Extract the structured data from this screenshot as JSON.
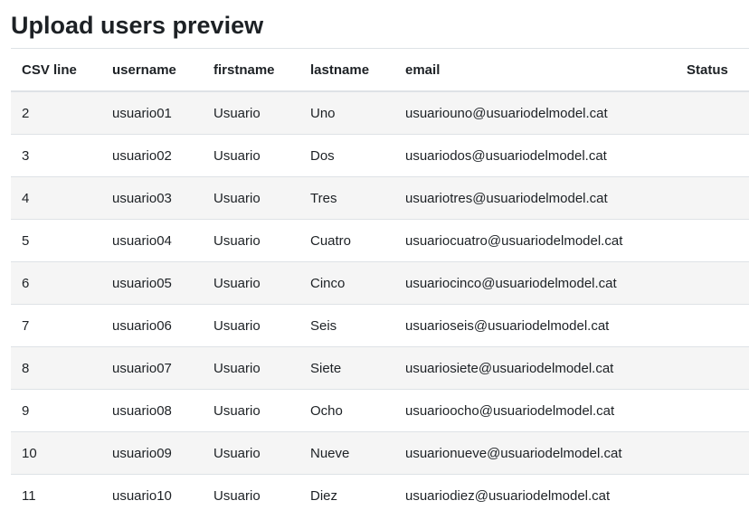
{
  "page": {
    "title": "Upload users preview"
  },
  "table": {
    "headers": {
      "csv_line": "CSV line",
      "username": "username",
      "firstname": "firstname",
      "lastname": "lastname",
      "email": "email",
      "status": "Status"
    },
    "rows": [
      {
        "line": "2",
        "username": "usuario01",
        "firstname": "Usuario",
        "lastname": "Uno",
        "email": "usuariouno@usuariodelmodel.cat",
        "status": ""
      },
      {
        "line": "3",
        "username": "usuario02",
        "firstname": "Usuario",
        "lastname": "Dos",
        "email": "usuariodos@usuariodelmodel.cat",
        "status": ""
      },
      {
        "line": "4",
        "username": "usuario03",
        "firstname": "Usuario",
        "lastname": "Tres",
        "email": "usuariotres@usuariodelmodel.cat",
        "status": ""
      },
      {
        "line": "5",
        "username": "usuario04",
        "firstname": "Usuario",
        "lastname": "Cuatro",
        "email": "usuariocuatro@usuariodelmodel.cat",
        "status": ""
      },
      {
        "line": "6",
        "username": "usuario05",
        "firstname": "Usuario",
        "lastname": "Cinco",
        "email": "usuariocinco@usuariodelmodel.cat",
        "status": ""
      },
      {
        "line": "7",
        "username": "usuario06",
        "firstname": "Usuario",
        "lastname": "Seis",
        "email": "usuarioseis@usuariodelmodel.cat",
        "status": ""
      },
      {
        "line": "8",
        "username": "usuario07",
        "firstname": "Usuario",
        "lastname": "Siete",
        "email": "usuariosiete@usuariodelmodel.cat",
        "status": ""
      },
      {
        "line": "9",
        "username": "usuario08",
        "firstname": "Usuario",
        "lastname": "Ocho",
        "email": "usuarioocho@usuariodelmodel.cat",
        "status": ""
      },
      {
        "line": "10",
        "username": "usuario09",
        "firstname": "Usuario",
        "lastname": "Nueve",
        "email": "usuarionueve@usuariodelmodel.cat",
        "status": ""
      },
      {
        "line": "11",
        "username": "usuario10",
        "firstname": "Usuario",
        "lastname": "Diez",
        "email": "usuariodiez@usuariodelmodel.cat",
        "status": ""
      }
    ]
  }
}
